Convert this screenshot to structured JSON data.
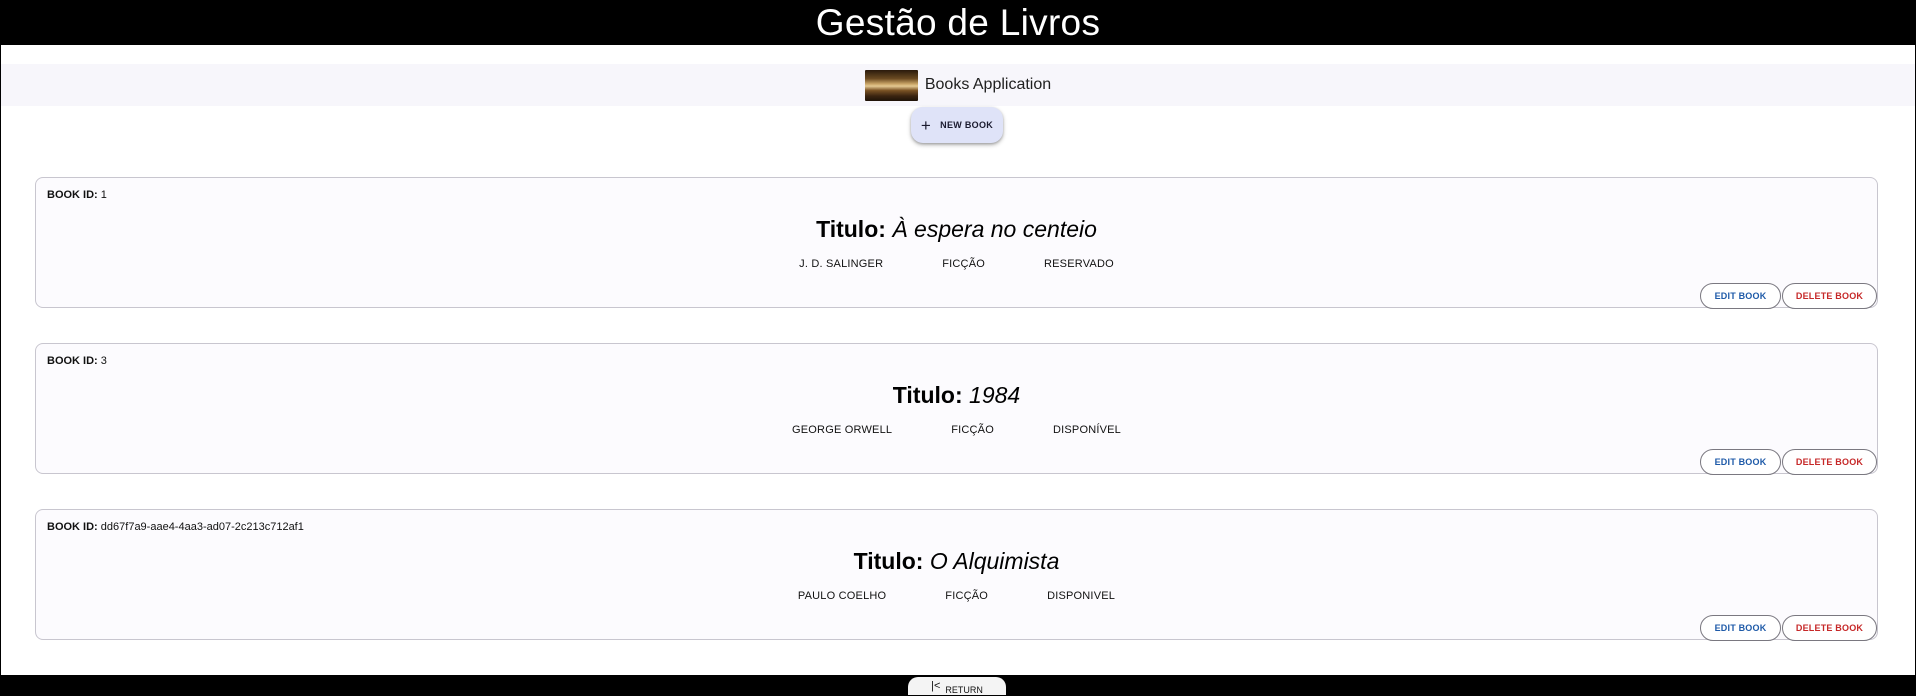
{
  "header": {
    "title": "Gestão de Livros"
  },
  "brand": {
    "name": "Books Application"
  },
  "toolbar": {
    "new_book_label": "NEW BOOK",
    "new_book_icon": "+"
  },
  "books": [
    {
      "id_label": "BOOK ID:",
      "id": "1",
      "title_label": "Titulo:",
      "title": "À espera no centeio",
      "author": "J. D. SALINGER",
      "genre": "FICÇÃO",
      "status": "RESERVADO",
      "edit_label": "EDIT BOOK",
      "delete_label": "DELETE BOOK"
    },
    {
      "id_label": "BOOK ID:",
      "id": "3",
      "title_label": "Titulo:",
      "title": "1984",
      "author": "GEORGE ORWELL",
      "genre": "FICÇÃO",
      "status": "DISPONÍVEL",
      "edit_label": "EDIT BOOK",
      "delete_label": "DELETE BOOK"
    },
    {
      "id_label": "BOOK ID:",
      "id": "dd67f7a9-aae4-4aa3-ad07-2c213c712af1",
      "title_label": "Titulo:",
      "title": "O Alquimista",
      "author": "PAULO COELHO",
      "genre": "FICÇÃO",
      "status": "DISPONIVEL",
      "edit_label": "EDIT BOOK",
      "delete_label": "DELETE BOOK"
    }
  ],
  "footer": {
    "return_label": "RETURN",
    "return_icon": "first-page-icon"
  },
  "colors": {
    "header_bg": "#000000",
    "edit_text": "#1e5aa8",
    "delete_text": "#c62828",
    "new_book_bg": "#dfe3f8",
    "card_bg": "#fcfbfe"
  }
}
